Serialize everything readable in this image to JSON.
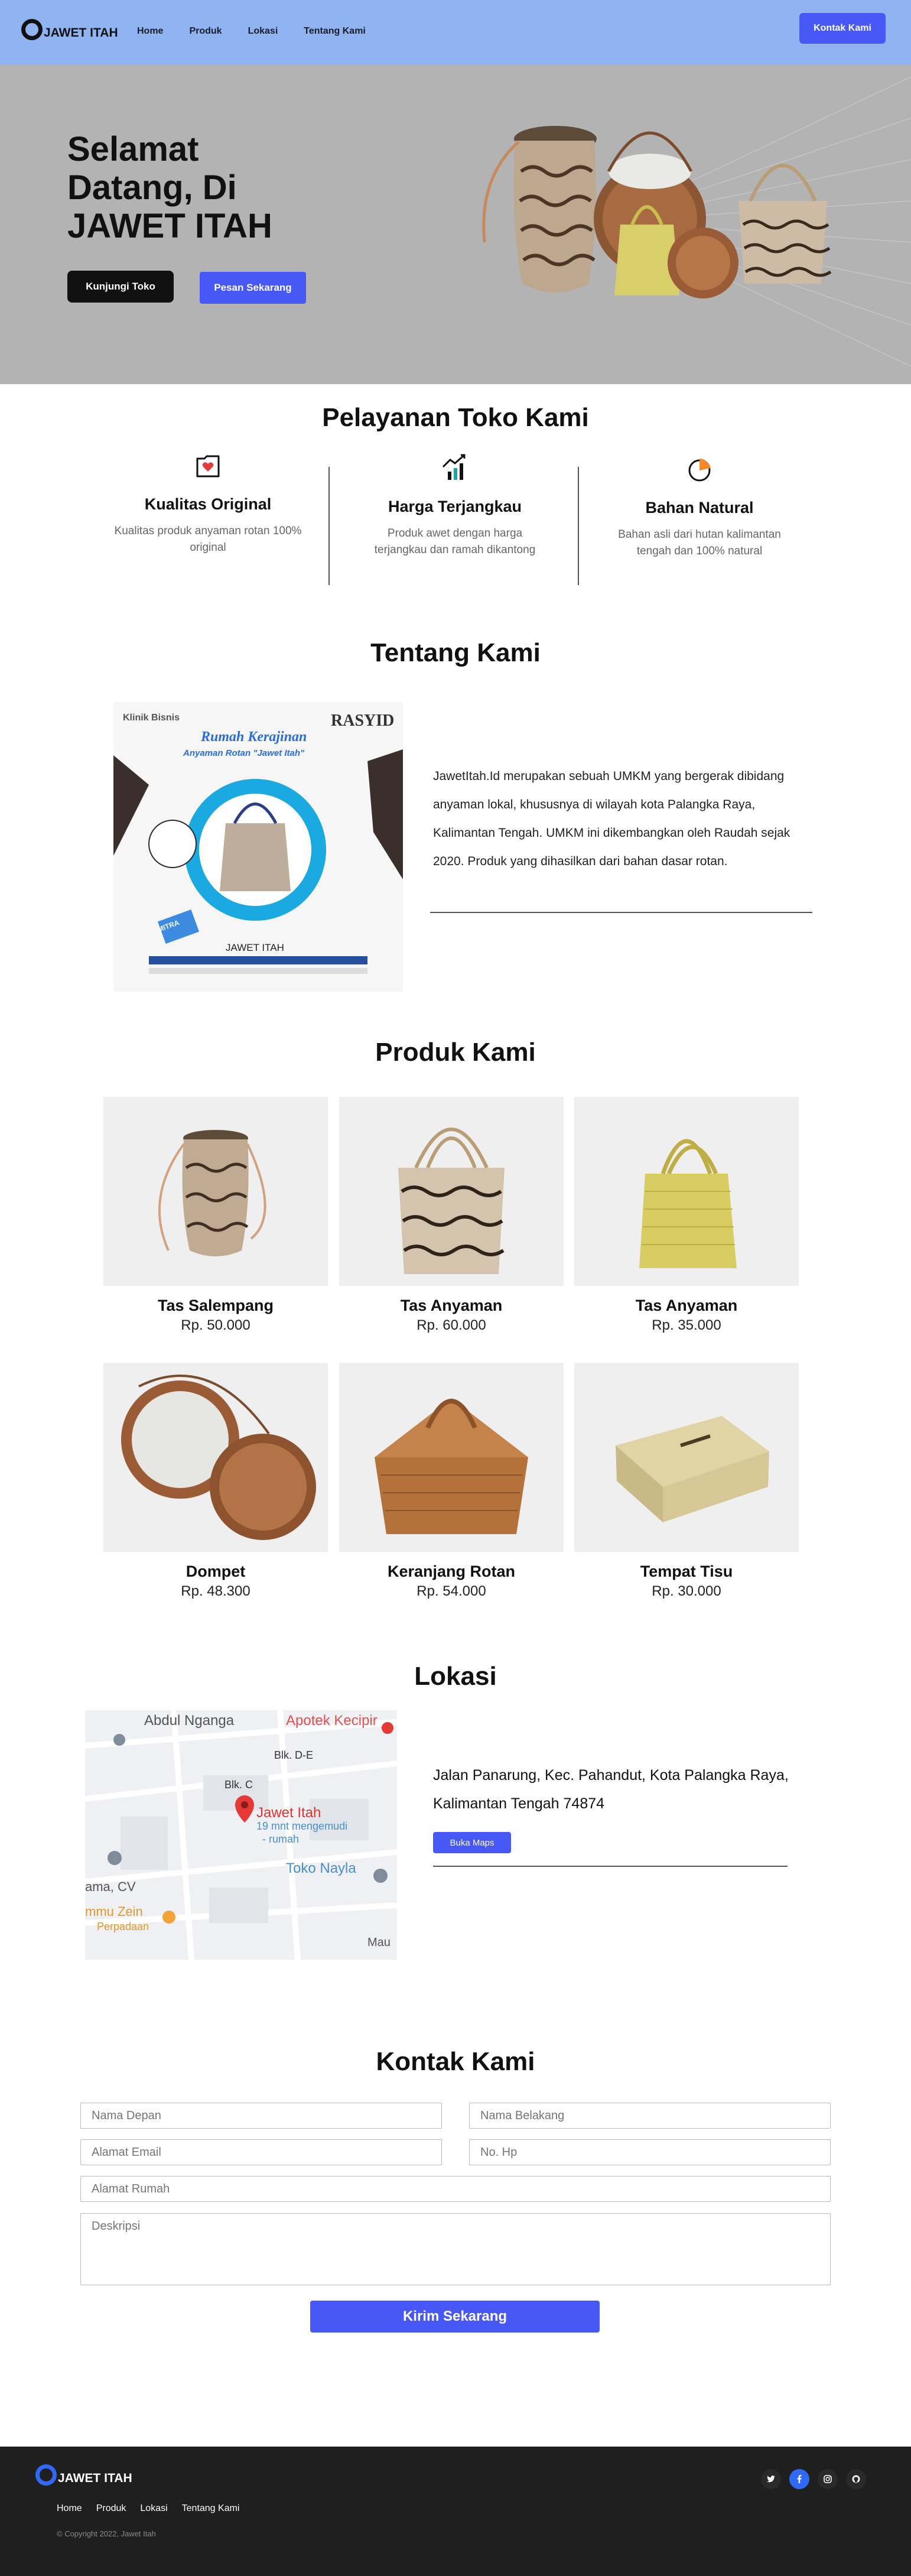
{
  "nav": {
    "logo_text": "JAWET ITAH",
    "links": [
      "Home",
      "Produk",
      "Lokasi",
      "Tentang Kami"
    ],
    "contact_button": "Kontak Kami"
  },
  "hero": {
    "title": "Selamat Datang, Di JAWET ITAH",
    "visit_button": "Kunjungi Toko",
    "order_button": "Pesan Sekarang"
  },
  "services": {
    "title": "Pelayanan Toko Kami",
    "items": [
      {
        "icon": "heart-box-icon",
        "title": "Kualitas Original",
        "desc": "Kualitas produk anyaman rotan 100% original"
      },
      {
        "icon": "chart-up-icon",
        "title": "Harga Terjangkau",
        "desc": "Produk awet dengan harga terjangkau dan ramah dikantong"
      },
      {
        "icon": "leaf-pie-icon",
        "title": "Bahan Natural",
        "desc": "Bahan asli dari hutan kalimantan tengah dan 100% natural"
      }
    ]
  },
  "about": {
    "title": "Tentang Kami",
    "text": "JawetItah.Id merupakan sebuah UMKM yang bergerak dibidang anyaman lokal, khususnya di wilayah kota Palangka Raya, Kalimantan Tengah. UMKM ini dikembangkan oleh Raudah sejak 2020. Produk yang dihasilkan dari bahan dasar rotan.",
    "poster": {
      "brand_left": "Klinik Bisnis",
      "brand_right": "RASYID",
      "headline": "Rumah Kerajinan",
      "subheadline": "Anyaman Rotan \"Jawet Itah\"",
      "badge": "MITRA",
      "owner_label": "JAWET ITAH"
    }
  },
  "products": {
    "title": "Produk Kami",
    "items": [
      {
        "name": "Tas Salempang",
        "price": "Rp. 50.000"
      },
      {
        "name": "Tas Anyaman",
        "price": "Rp. 60.000"
      },
      {
        "name": "Tas Anyaman",
        "price": "Rp. 35.000"
      },
      {
        "name": "Dompet",
        "price": "Rp. 48.300"
      },
      {
        "name": "Keranjang Rotan",
        "price": "Rp. 54.000"
      },
      {
        "name": "Tempat Tisu",
        "price": "Rp. 30.000"
      }
    ]
  },
  "location": {
    "title": "Lokasi",
    "address": "Jalan Panarung, Kec. Pahandut, Kota Palangka Raya, Kalimantan Tengah 74874",
    "maps_button": "Buka Maps",
    "map_labels": {
      "place1": "Abdul Nganga",
      "place2": "Apotek Kecipir",
      "street1": "Blk. D-E",
      "street2": "Blk. C",
      "pin_name": "Jawet Itah",
      "pin_sub1": "19 mnt mengemudi",
      "pin_sub2": "- rumah",
      "shop": "Toko Nayla",
      "left": "ama, CV",
      "food1": "mmu Zein",
      "food2": "Perpadaan",
      "right": "Mau"
    }
  },
  "contact": {
    "title": "Kontak Kami",
    "first_name": "Nama Depan",
    "last_name": "Nama Belakang",
    "email": "Alamat Email",
    "phone": "No. Hp",
    "address": "Alamat Rumah",
    "description": "Deskripsi",
    "submit": "Kirim Sekarang"
  },
  "footer": {
    "logo_text": "JAWET ITAH",
    "links": [
      "Home",
      "Produk",
      "Lokasi",
      "Tentang Kami"
    ],
    "copyright": "© Copyright 2022, Jawet Itah",
    "social": [
      "twitter-icon",
      "facebook-icon",
      "instagram-icon",
      "github-icon"
    ]
  },
  "colors": {
    "nav_bg": "#8fb4f1",
    "hero_bg": "#b3b3b3",
    "accent": "#4858f7",
    "footer_bg": "#1f1f1f"
  }
}
